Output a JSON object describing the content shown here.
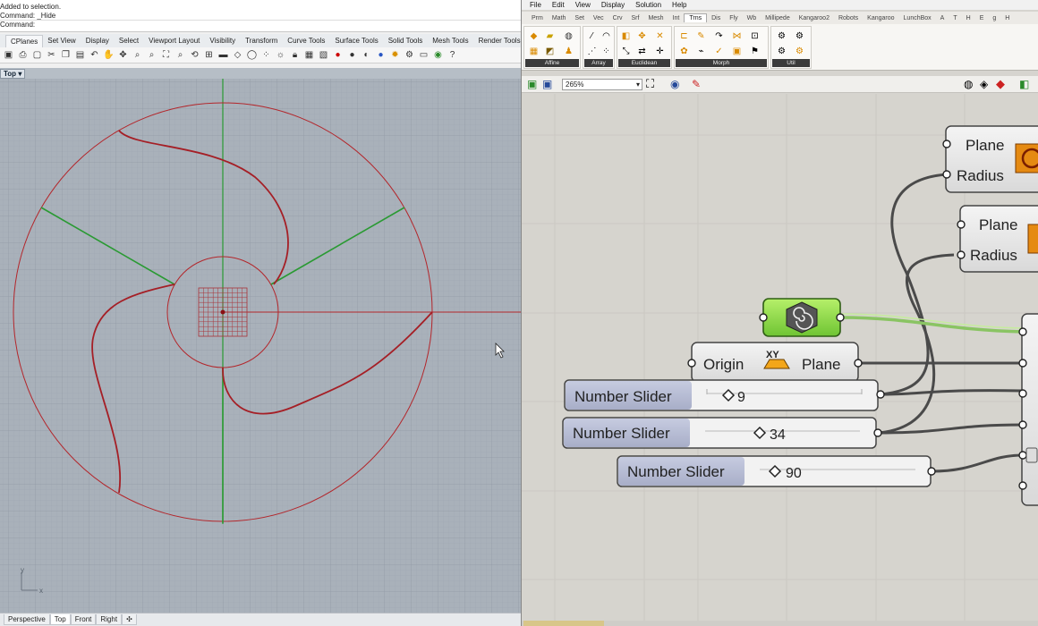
{
  "rhino": {
    "command_history": [
      "Added to selection.",
      "Command: _Hide",
      "Command:"
    ],
    "tabs": [
      "CPlanes",
      "Set View",
      "Display",
      "Select",
      "Viewport Layout",
      "Visibility",
      "Transform",
      "Curve Tools",
      "Surface Tools",
      "Solid Tools",
      "Mesh Tools",
      "Render Tools"
    ],
    "viewport_label": "Top",
    "viewport_tabs": [
      "Perspective",
      "Top",
      "Front",
      "Right"
    ],
    "viewport_tab_active": "Top",
    "axis_labels": {
      "x": "x",
      "y": "y"
    }
  },
  "grasshopper": {
    "menu": [
      "File",
      "Edit",
      "View",
      "Display",
      "Solution",
      "Help"
    ],
    "tabs": [
      "Prm",
      "Math",
      "Set",
      "Vec",
      "Crv",
      "Srf",
      "Mesh",
      "Int",
      "Trns",
      "Dis",
      "Fly",
      "Wb",
      "Millipede",
      "Kangaroo2",
      "Robots",
      "Kangaroo",
      "LunchBox",
      "A",
      "T",
      "H",
      "E",
      "g",
      "H"
    ],
    "active_tab": "Trns",
    "groups": [
      "Affine",
      "Array",
      "Euclidean",
      "Morph",
      "Util"
    ],
    "zoom": "265%",
    "nodes": {
      "circle1": {
        "inputs": [
          "Plane",
          "Radius"
        ]
      },
      "circle2": {
        "inputs": [
          "Plane",
          "Radius"
        ]
      },
      "xy_plane": {
        "input": "Origin",
        "icon": "XY",
        "output": "Plane"
      },
      "sliders": [
        {
          "label": "Number Slider",
          "value": "9"
        },
        {
          "label": "Number Slider",
          "value": "34"
        },
        {
          "label": "Number Slider",
          "value": "90"
        }
      ]
    }
  },
  "colors": {
    "rhino_grid_bg": "#a9b1ba",
    "curve_red": "#b3262b",
    "axis_green": "#2a9a33",
    "gh_canvas": "#d6d4ce",
    "wire_green": "#8ac463"
  }
}
